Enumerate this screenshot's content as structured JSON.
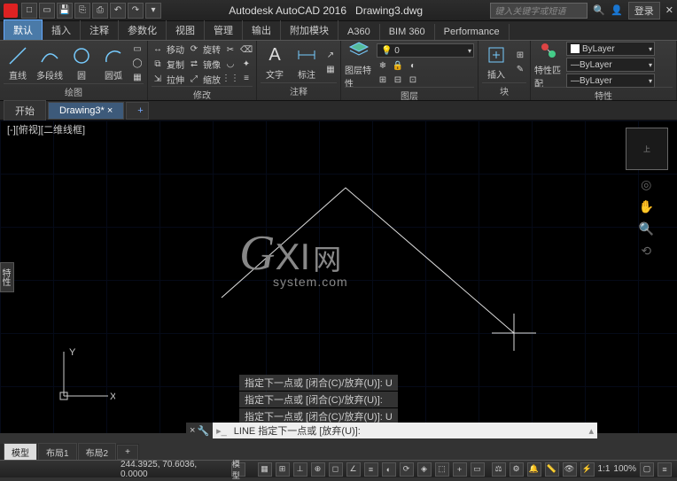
{
  "title": {
    "app": "Autodesk AutoCAD 2016",
    "file": "Drawing3.dwg"
  },
  "search_placeholder": "键入关键字或短语",
  "login_label": "登录",
  "tabs": [
    "默认",
    "插入",
    "注释",
    "参数化",
    "视图",
    "管理",
    "输出",
    "附加模块",
    "A360",
    "BIM 360",
    "Performance"
  ],
  "ribbon": {
    "draw_panel": "绘图",
    "line": "直线",
    "polyline": "多段线",
    "circle": "圆",
    "arc": "圆弧",
    "modify_panel": "修改",
    "move": "移动",
    "rotate": "旋转",
    "copy": "复制",
    "mirror": "镜像",
    "stretch": "拉伸",
    "scale": "缩放",
    "annot_panel": "注释",
    "text": "文字",
    "dim": "标注",
    "layer_panel": "图层",
    "layer_prop": "图层特性",
    "block_panel": "块",
    "insert": "插入",
    "prop_panel": "特性",
    "prop_match": "特性匹配",
    "bylayer": "ByLayer"
  },
  "filetabs": {
    "start": "开始",
    "drawing": "Drawing3*",
    "plus": "+"
  },
  "viewport_label": "[-][俯视][二维线框]",
  "side_tab": "特性",
  "viewcube_top": "上",
  "watermark": {
    "brand": "GXI",
    "suffix": "网",
    "sub": "system.com"
  },
  "ucs": {
    "x": "X",
    "y": "Y"
  },
  "cmd_history": [
    "指定下一点或 [闭合(C)/放弃(U)]: U",
    "指定下一点或 [闭合(C)/放弃(U)]:",
    "指定下一点或 [闭合(C)/放弃(U)]: U"
  ],
  "cmd_line": "LINE 指定下一点或 [放弃(U)]:",
  "model_tabs": {
    "model": "模型",
    "layout1": "布局1",
    "layout2": "布局2",
    "plus": "+"
  },
  "status": {
    "coords": "244.3925, 70.6036, 0.0000",
    "model_btn": "模型",
    "scale": "1:1",
    "zoom": "100%"
  }
}
